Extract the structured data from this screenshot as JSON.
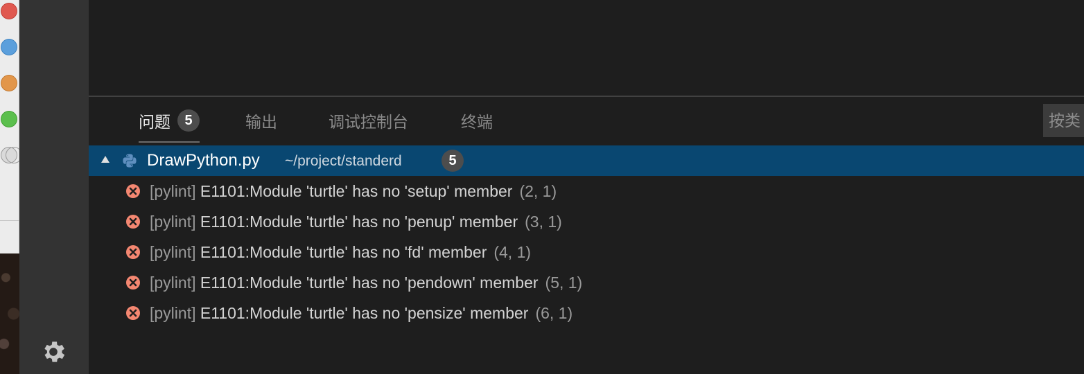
{
  "panel": {
    "tabs": [
      {
        "label": "问题",
        "badge": "5"
      },
      {
        "label": "输出"
      },
      {
        "label": "调试控制台"
      },
      {
        "label": "终端"
      }
    ],
    "filter_placeholder": "按类"
  },
  "file": {
    "name": "DrawPython.py",
    "path": "~/project/standerd",
    "count": "5"
  },
  "problems": [
    {
      "source": "[pylint]",
      "message": "E1101:Module 'turtle' has no 'setup' member",
      "location": "(2, 1)"
    },
    {
      "source": "[pylint]",
      "message": "E1101:Module 'turtle' has no 'penup' member",
      "location": "(3, 1)"
    },
    {
      "source": "[pylint]",
      "message": "E1101:Module 'turtle' has no 'fd' member",
      "location": "(4, 1)"
    },
    {
      "source": "[pylint]",
      "message": "E1101:Module 'turtle' has no 'pendown' member",
      "location": "(5, 1)"
    },
    {
      "source": "[pylint]",
      "message": "E1101:Module 'turtle' has no 'pensize' member",
      "location": "(6, 1)"
    }
  ],
  "colors": {
    "selection": "#094771",
    "error": "#f48771",
    "background": "#1e1e1e",
    "activity_bar": "#333333"
  },
  "icons": {
    "settings": "gear-icon",
    "file": "python-icon",
    "error": "error-icon",
    "expand": "collapse-triangle-icon"
  }
}
